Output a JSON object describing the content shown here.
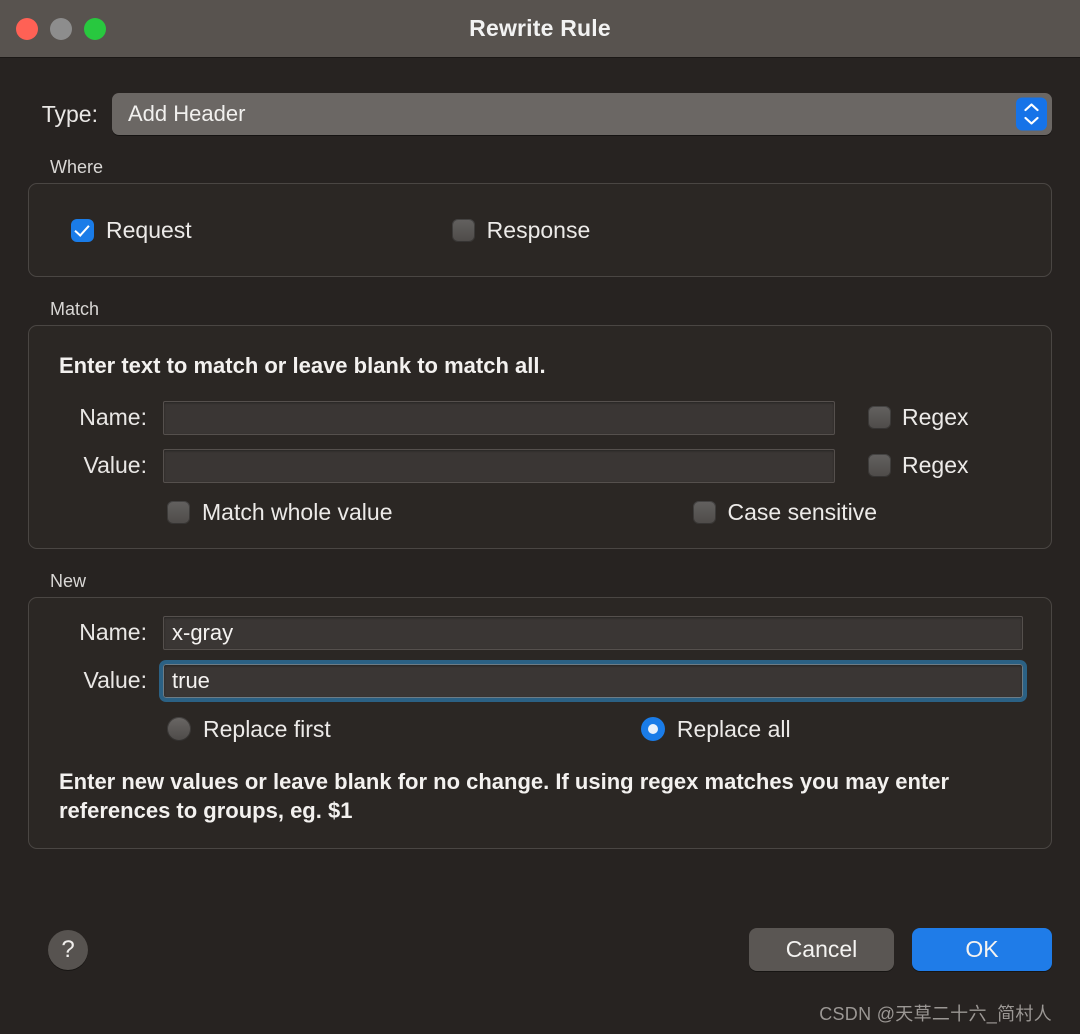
{
  "window": {
    "title": "Rewrite Rule",
    "traffic_lights": [
      {
        "name": "close",
        "color": "#ff6155"
      },
      {
        "name": "minimize",
        "color": "#8d8d8d"
      },
      {
        "name": "zoom",
        "color": "#28c83f"
      }
    ]
  },
  "type_row": {
    "label": "Type:",
    "selected": "Add Header"
  },
  "where": {
    "group_label": "Where",
    "request": {
      "label": "Request",
      "checked": true
    },
    "response": {
      "label": "Response",
      "checked": false
    }
  },
  "match": {
    "group_label": "Match",
    "hint": "Enter text to match or leave blank to match all.",
    "name": {
      "label": "Name:",
      "value": "",
      "regex_label": "Regex",
      "regex_checked": false
    },
    "value": {
      "label": "Value:",
      "value": "",
      "regex_label": "Regex",
      "regex_checked": false
    },
    "whole_value": {
      "label": "Match whole value",
      "checked": false
    },
    "case_sensitive": {
      "label": "Case sensitive",
      "checked": false
    }
  },
  "new": {
    "group_label": "New",
    "name": {
      "label": "Name:",
      "value": "x-gray"
    },
    "value": {
      "label": "Value:",
      "value": "true",
      "focused": true
    },
    "replace_first": {
      "label": "Replace first",
      "selected": false
    },
    "replace_all": {
      "label": "Replace all",
      "selected": true
    },
    "hint": "Enter new values or leave blank for no change. If using regex matches you may enter references to groups, eg. $1"
  },
  "footer": {
    "help_label": "?",
    "cancel_label": "Cancel",
    "ok_label": "OK",
    "watermark": "CSDN @天草二十六_简村人"
  },
  "colors": {
    "accent_blue": "#1a7ce8",
    "ok_blue": "#1f7ce8",
    "focus_ring": "#2b6184",
    "window_bg": "#272321",
    "titlebar_bg": "#58534f"
  }
}
